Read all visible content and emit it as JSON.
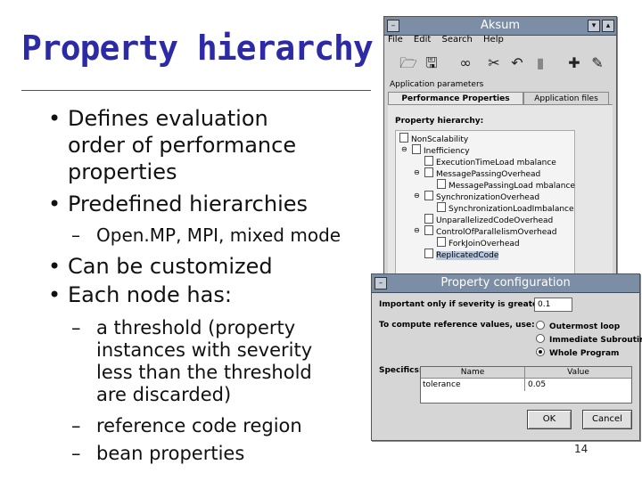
{
  "slide": {
    "title": "Property hierarchy",
    "bullets": {
      "b1": "Defines evaluation",
      "b1_l2": "order of performance",
      "b1_l3": "properties",
      "b2": "Predefined hierarchies",
      "b2_sub": "Open.MP, MPI, mixed mode",
      "b3": "Can be customized",
      "b4": "Each node has:",
      "b4_sub1_l1": "a threshold (property",
      "b4_sub1_l2": "instances with severity",
      "b4_sub1_l3": "less than the threshold",
      "b4_sub1_l4": "are discarded)",
      "b4_sub2": "reference code region",
      "b4_sub3": "bean properties"
    },
    "bullet_glyph": "•",
    "dash_glyph": "–",
    "page_number": "14"
  },
  "aksum": {
    "title": "Aksum",
    "menu": [
      "File",
      "Edit",
      "Search",
      "Help"
    ],
    "toolbar_icons": [
      "folder-open-icon",
      "save-icon",
      "binoculars-icon",
      "cut-icon",
      "undo-icon",
      "delete-icon",
      "new-icon",
      "edit-icon"
    ],
    "tab_group": "Application parameters",
    "tabs": [
      "Performance Properties",
      "Application files"
    ],
    "tree_title": "Property hierarchy:",
    "tree": [
      "NonScalability",
      "Inefficiency",
      "ExecutionTimeLoad mbalance",
      "MessagePassingOverhead",
      "MessagePassingLoad mbalance",
      "SynchronizationOverhead",
      "SynchronizationLoadImbalance",
      "UnparallelizedCodeOverhead",
      "ControlOfParallelismOverhead",
      "ForkJoinOverhead",
      "ReplicatedCode"
    ]
  },
  "config": {
    "title": "Property configuration",
    "threshold_label": "Important only if severity is greater than:",
    "threshold_value": "0.1",
    "reference_label": "To compute reference values, use:",
    "options": [
      "Outermost loop",
      "Immediate Subroutine",
      "Whole Program"
    ],
    "selected_option": "Whole Program",
    "specifics_label": "Specifics:",
    "col_name": "Name",
    "col_value": "Value",
    "row_name": "tolerance",
    "row_value": "0.05",
    "ok": "OK",
    "cancel": "Cancel"
  }
}
